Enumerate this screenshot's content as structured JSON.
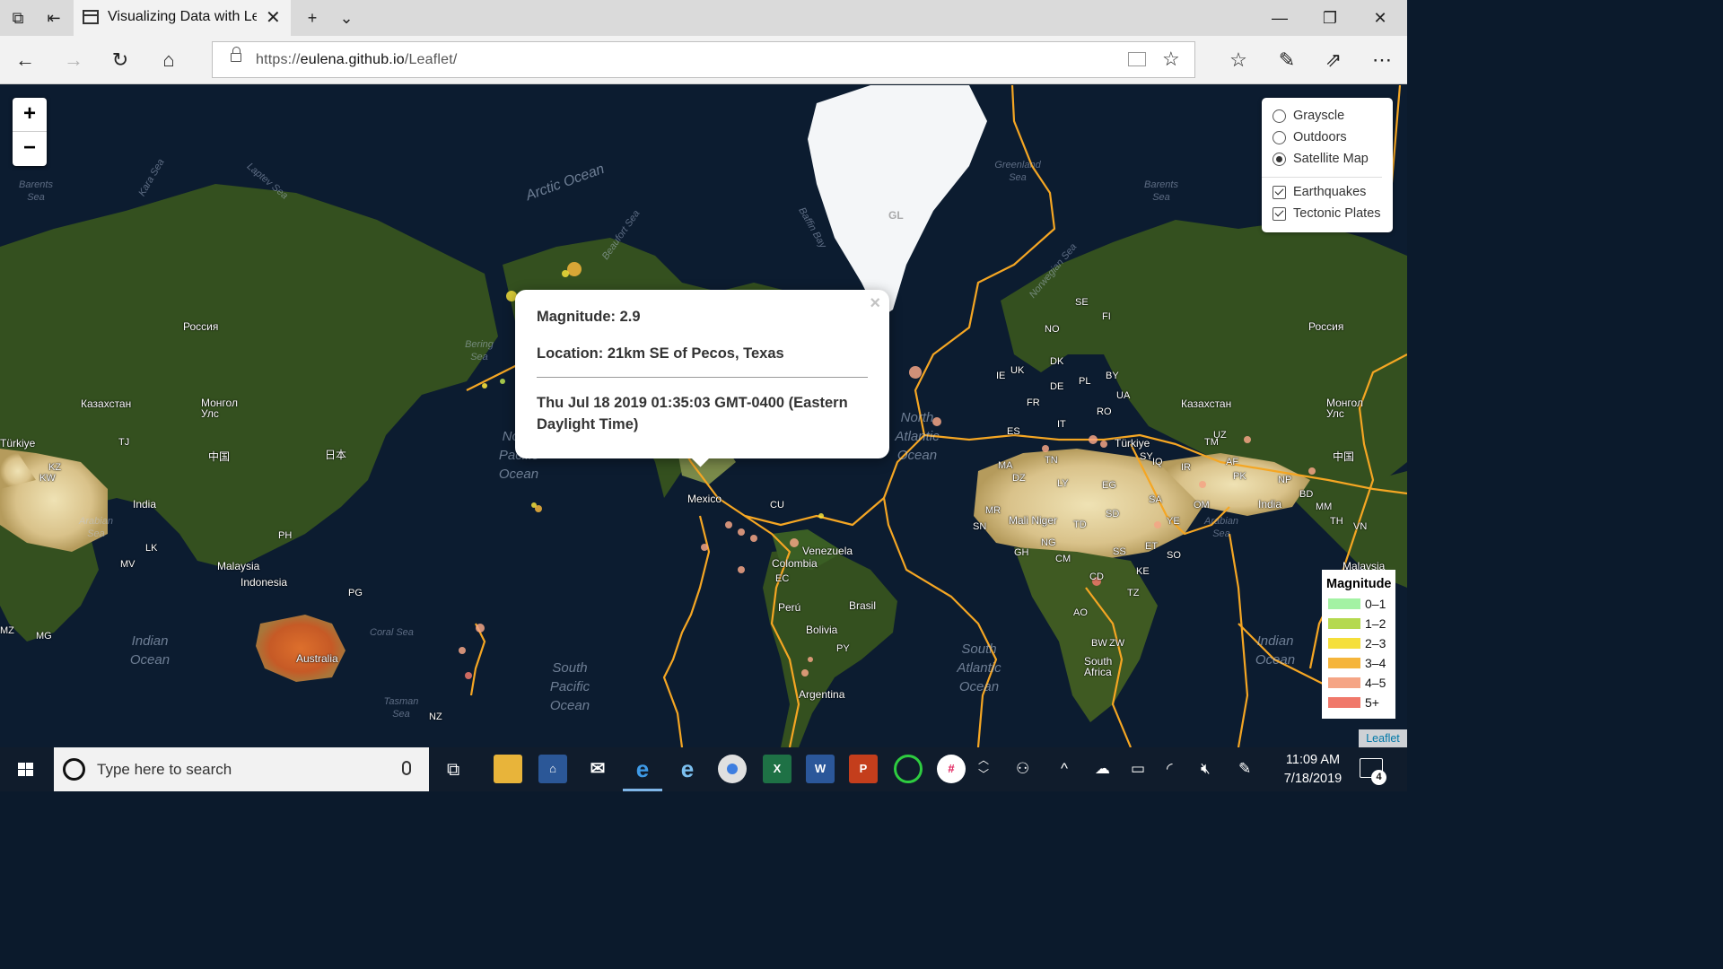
{
  "browser": {
    "tab_title": "Visualizing Data with Leaflet",
    "url_scheme": "https://",
    "url_host": "eulena.github.io",
    "url_path": "/Leaflet/"
  },
  "map": {
    "zoom_in_label": "+",
    "zoom_out_label": "−",
    "base_layers": [
      {
        "label": "Grayscle",
        "selected": false
      },
      {
        "label": "Outdoors",
        "selected": false
      },
      {
        "label": "Satellite Map",
        "selected": true
      }
    ],
    "overlays": [
      {
        "label": "Earthquakes",
        "checked": true
      },
      {
        "label": "Tectonic Plates",
        "checked": true
      }
    ],
    "popup": {
      "close_label": "×",
      "magnitude": "Magnitude: 2.9",
      "location": "Location: 21km SE of Pecos, Texas",
      "time": "Thu Jul 18 2019 01:35:03 GMT-0400 (Eastern Daylight Time)"
    },
    "legend": {
      "title": "Magnitude",
      "items": [
        {
          "label": "0–1",
          "color": "#a3f2a3"
        },
        {
          "label": "1–2",
          "color": "#b5d94f"
        },
        {
          "label": "2–3",
          "color": "#f5df3b"
        },
        {
          "label": "3–4",
          "color": "#f5b53b"
        },
        {
          "label": "4–5",
          "color": "#f5a585"
        },
        {
          "label": "5+",
          "color": "#f0786a"
        }
      ]
    },
    "attribution": "Leaflet",
    "labels": {
      "russia_left": "Россия",
      "russia_right": "Россия",
      "kazakhstan_left": "Казахстан",
      "kazakhstan_right": "Казахстан",
      "mongolia_left": "Монгол Улс",
      "mongolia_right": "Монгол Улс",
      "china_left": "中国",
      "china_right": "中国",
      "japan": "日本",
      "india_left": "India",
      "india_right": "India",
      "malaysia_left": "Malaysia",
      "malaysia_right": "Malaysia",
      "indonesia": "Indonesia",
      "australia": "Australia",
      "mexico": "Mexico",
      "venezuela": "Venezuela",
      "colombia": "Colombia",
      "peru": "Perú",
      "bolivia": "Bolivia",
      "brasil": "Brasil",
      "argentina": "Argentina",
      "mali_niger": "Mali Niger",
      "south_africa": "South Africa",
      "turkiye_left": "Türkiye",
      "turkiye_right": "Türkiye",
      "greenland_code": "GL",
      "arctic_ocean": "Arctic Ocean",
      "north_atlantic": "North Atlantic Ocean",
      "north_pacific": "North Pacific Ocean",
      "south_pacific": "South Pacific Ocean",
      "south_atlantic": "South Atlantic Ocean",
      "indian_left": "Indian Ocean",
      "indian_right": "Indian Ocean",
      "barents_left": "Barents Sea",
      "barents_right": "Barents Sea",
      "kara_sea": "Kara Sea",
      "laptev_sea": "Laptev Sea",
      "bering_sea": "Bering Sea",
      "beaufort_sea": "Beaufort Sea",
      "baffin_bay": "Baffin Bay",
      "greenland_sea": "Greenland Sea",
      "norwegian_sea": "Norwegian Sea",
      "arabian_left": "Arabian Sea",
      "arabian_right": "Arabian Sea",
      "coral_sea": "Coral Sea",
      "tasman_sea": "Tasman Sea"
    },
    "country_codes": [
      "SE",
      "FI",
      "NO",
      "DK",
      "UK",
      "IE",
      "PL",
      "BY",
      "UA",
      "DE",
      "FR",
      "RO",
      "IT",
      "ES",
      "MA",
      "TN",
      "DZ",
      "LY",
      "EG",
      "SA",
      "IQ",
      "IR",
      "AF",
      "PK",
      "NP",
      "BD",
      "MM",
      "TH",
      "VN",
      "PH",
      "LK",
      "MV",
      "PG",
      "NZ",
      "MG",
      "MZ",
      "ZW",
      "BW",
      "AO",
      "CD",
      "CM",
      "NG",
      "GH",
      "SN",
      "TD",
      "SD",
      "ET",
      "SO",
      "KE",
      "TZ",
      "YE",
      "OM",
      "CU",
      "EC",
      "PY",
      "UZ",
      "TM",
      "KZ",
      "TJ",
      "KW",
      "SY",
      "SS",
      "MR"
    ]
  },
  "taskbar": {
    "search_placeholder": "Type here to search",
    "time": "11:09 AM",
    "date": "7/18/2019",
    "notification_count": "4"
  }
}
